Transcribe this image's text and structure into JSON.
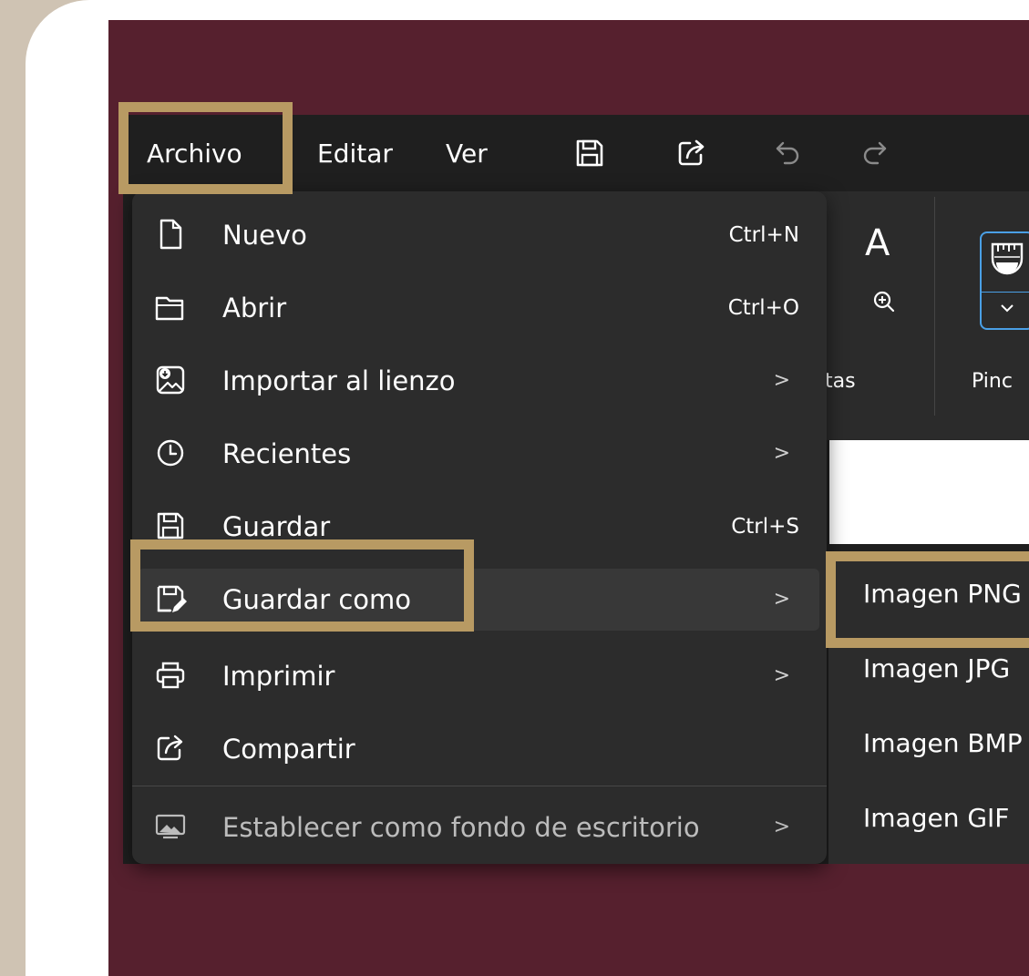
{
  "menubar": {
    "items": [
      {
        "label": "Archivo"
      },
      {
        "label": "Editar"
      },
      {
        "label": "Ver"
      }
    ],
    "icons": [
      "save-icon",
      "share-icon",
      "undo-icon",
      "redo-icon"
    ]
  },
  "ribbon": {
    "text_tool_glyph": "A",
    "tools_label_fragment": "tas",
    "brushes_label_fragment": "Pinc"
  },
  "file_menu": {
    "items": [
      {
        "label": "Nuevo",
        "shortcut": "Ctrl+N",
        "icon": "new-file-icon"
      },
      {
        "label": "Abrir",
        "shortcut": "Ctrl+O",
        "icon": "folder-open-icon"
      },
      {
        "label": "Importar al lienzo",
        "icon": "import-image-icon",
        "submenu_glyph": ">"
      },
      {
        "label": "Recientes",
        "icon": "clock-icon",
        "submenu_glyph": ">"
      },
      {
        "label": "Guardar",
        "shortcut": "Ctrl+S",
        "icon": "save-icon"
      },
      {
        "label": "Guardar como",
        "icon": "save-as-icon",
        "submenu_glyph": ">"
      },
      {
        "label": "Imprimir",
        "icon": "printer-icon",
        "submenu_glyph": ">"
      },
      {
        "label": "Compartir",
        "icon": "share-icon"
      },
      {
        "label": "Establecer como fondo de escritorio",
        "icon": "desktop-wallpaper-icon",
        "submenu_glyph": ">"
      }
    ]
  },
  "save_as_submenu": {
    "items": [
      {
        "label": "Imagen PNG"
      },
      {
        "label": "Imagen JPG"
      },
      {
        "label": "Imagen BMP"
      },
      {
        "label": "Imagen GIF"
      }
    ]
  },
  "colors": {
    "background": "#56202e",
    "highlight": "#b89a63",
    "menu": "#2c2c2c",
    "accent": "#4aa0e6"
  }
}
